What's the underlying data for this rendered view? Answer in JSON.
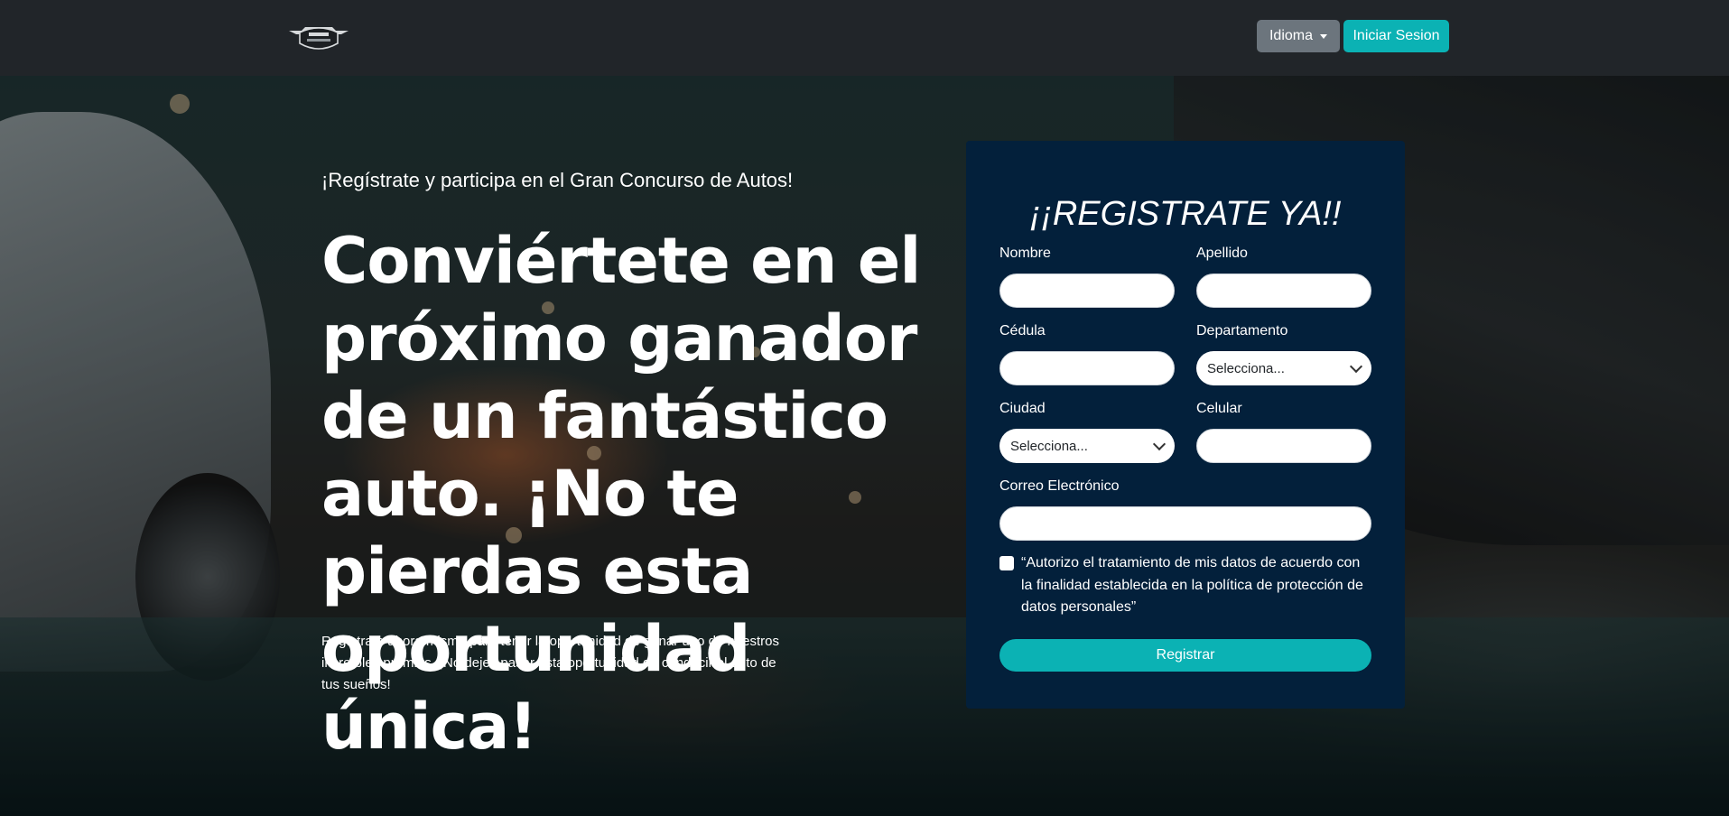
{
  "navbar": {
    "logo_icon": "car-emblem-logo",
    "language_label": "Idioma",
    "login_label": "Iniciar Sesion"
  },
  "hero": {
    "subtitle": "¡Regístrate y participa en el Gran Concurso de Autos!",
    "headline": "Conviértete en el próximo ganador de un fantástico auto. ¡No te pierdas esta oportunidad única!",
    "description": "Regístrate ahora mismo para tener la oportunidad de ganar uno de nuestros increíbles premios. ¡No dejes pasar esta oportunidad de conducir el auto de tus sueños!"
  },
  "form": {
    "title": "¡¡REGISTRATE YA!!",
    "fields": {
      "nombre": {
        "label": "Nombre",
        "value": ""
      },
      "apellido": {
        "label": "Apellido",
        "value": ""
      },
      "cedula": {
        "label": "Cédula",
        "value": ""
      },
      "departamento": {
        "label": "Departamento",
        "selected": "Selecciona..."
      },
      "ciudad": {
        "label": "Ciudad",
        "selected": "Selecciona..."
      },
      "celular": {
        "label": "Celular",
        "value": ""
      },
      "correo": {
        "label": "Correo Electrónico",
        "value": ""
      }
    },
    "consent_text": "“Autorizo el tratamiento de mis datos de acuerdo con la finalidad establecida en la política de protección de datos personales”",
    "consent_checked": false,
    "submit_label": "Registrar"
  },
  "colors": {
    "navbar_bg": "#212529",
    "accent": "#0bb2b4",
    "secondary_button": "#6c757d",
    "form_bg": "#03203b"
  }
}
